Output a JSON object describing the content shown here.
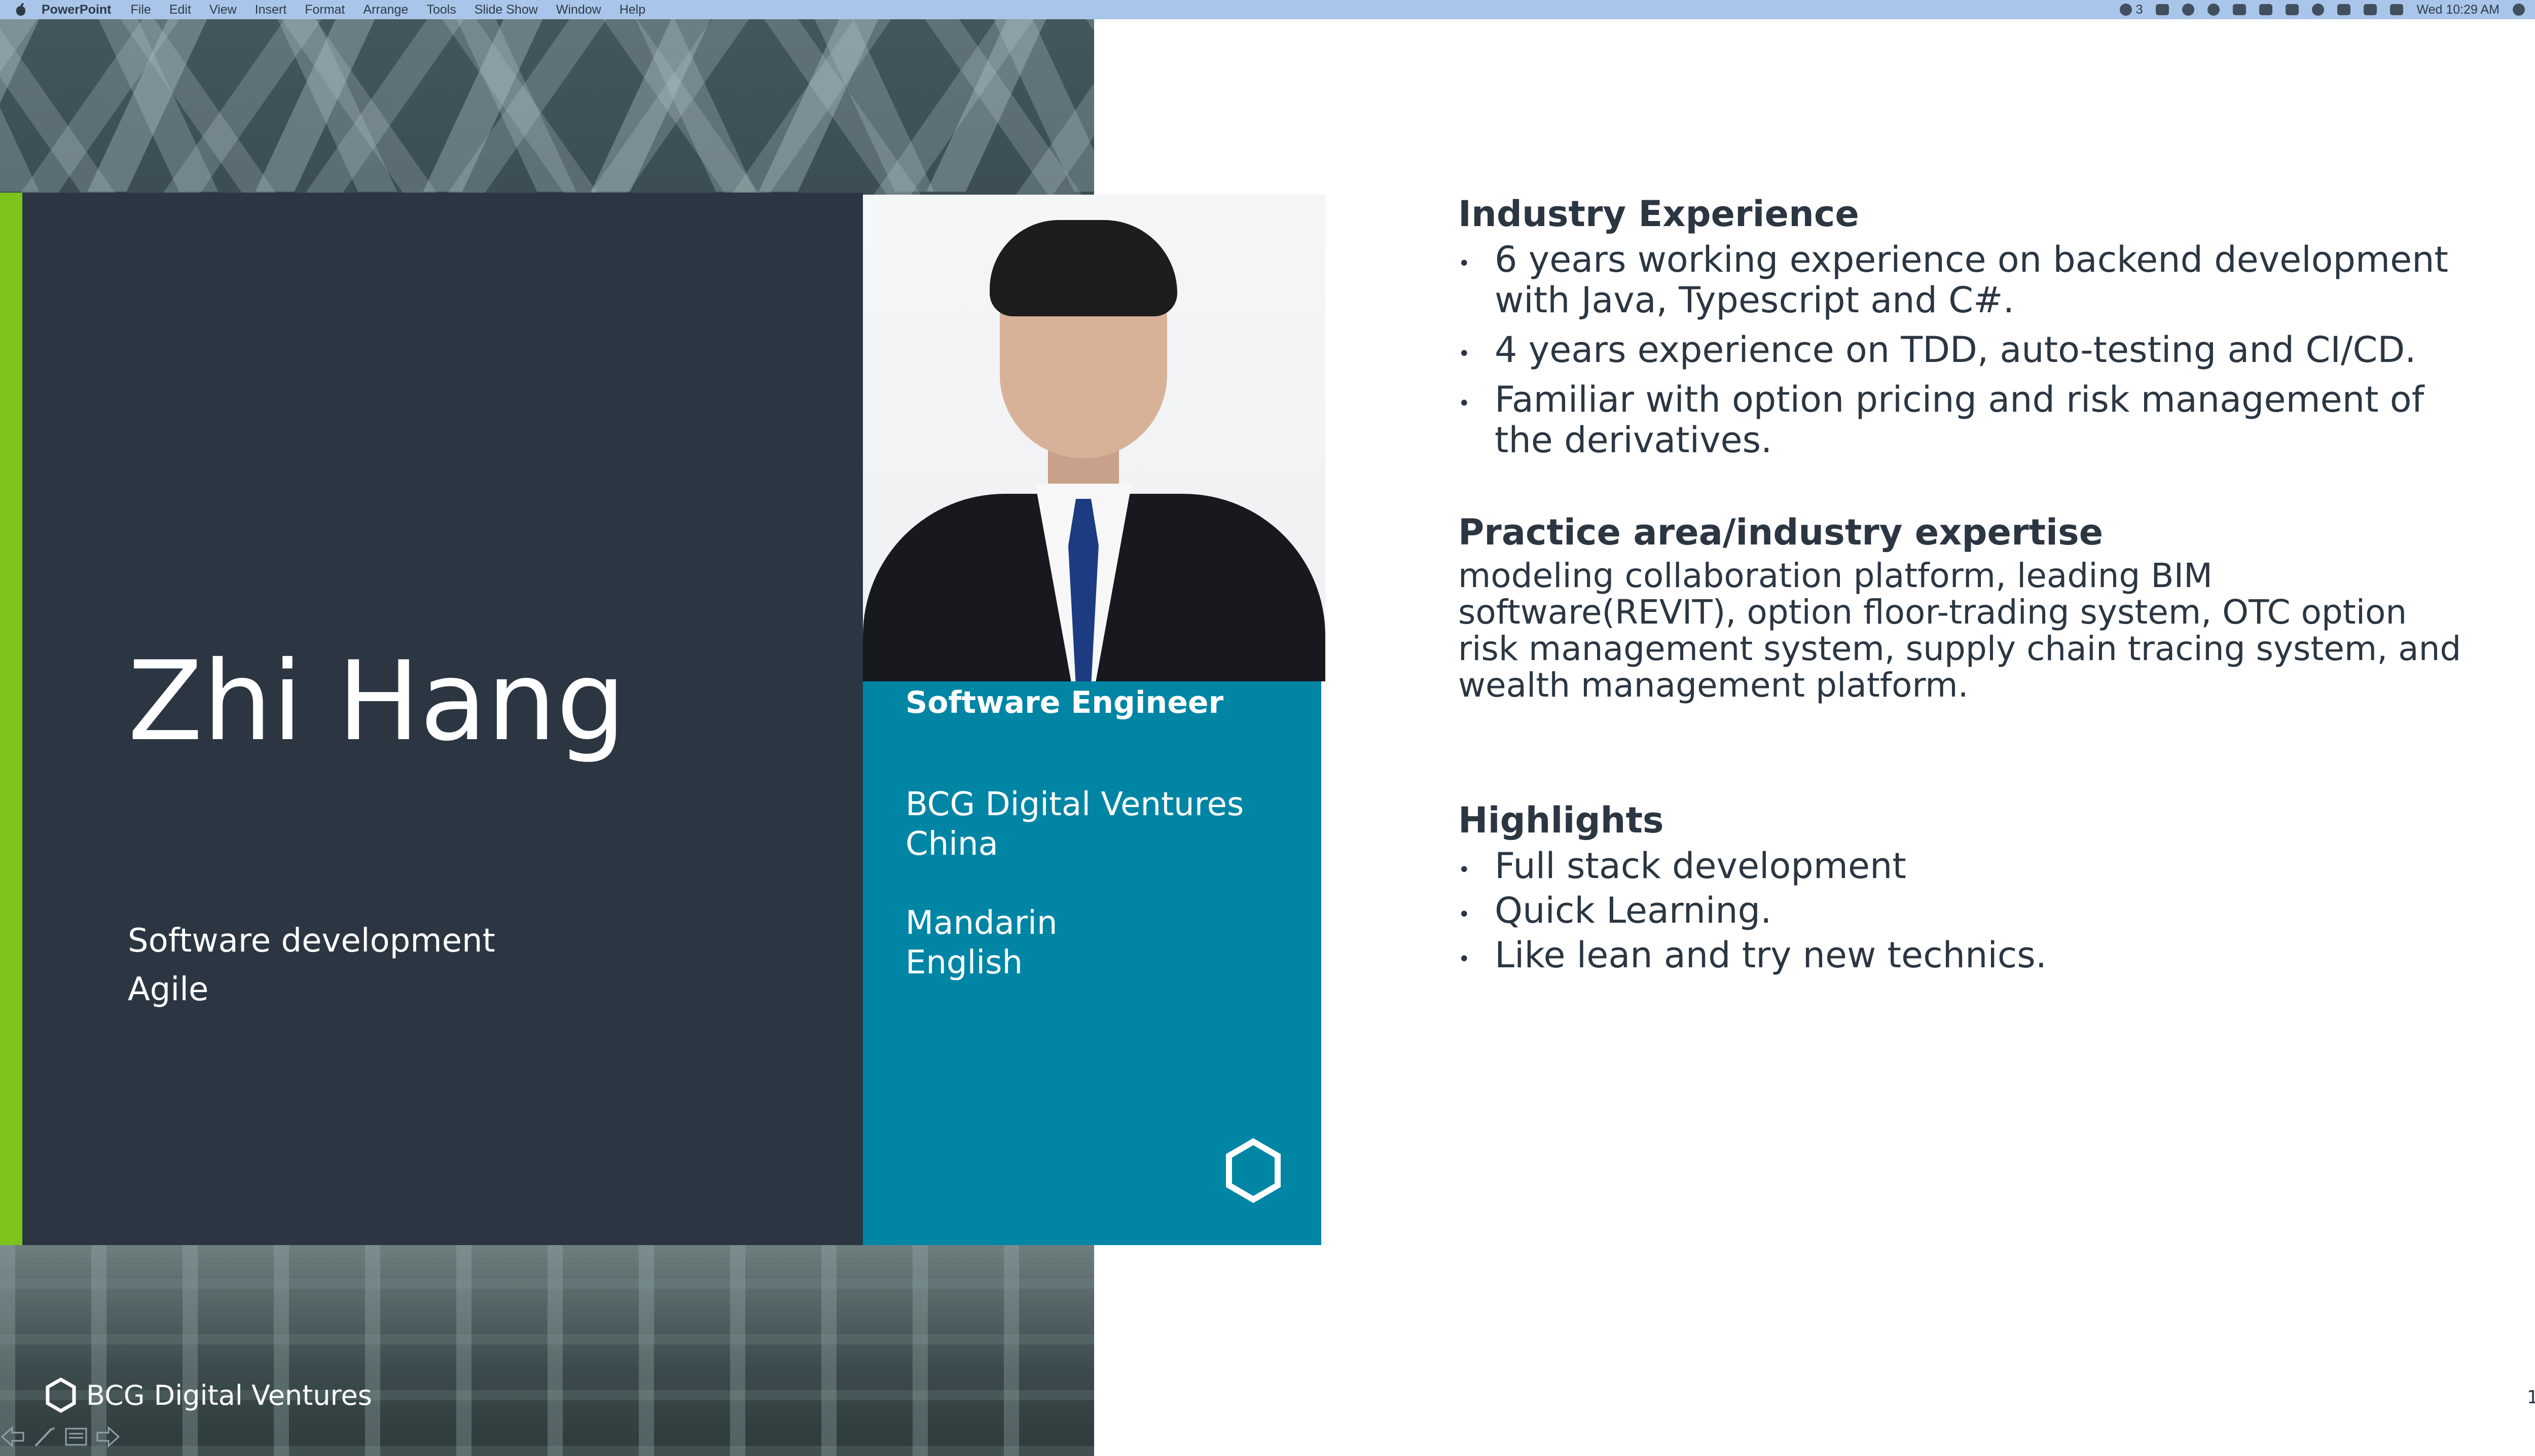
{
  "menubar": {
    "app_name": "PowerPoint",
    "items": [
      "File",
      "Edit",
      "View",
      "Insert",
      "Format",
      "Arrange",
      "Tools",
      "Slide Show",
      "Window",
      "Help"
    ],
    "wechat_count": "3",
    "clock": "Wed 10:29 AM"
  },
  "slide": {
    "name": "Zhi Hang",
    "skills": [
      "Software development",
      "Agile"
    ],
    "role": "Software Engineer",
    "company_lines": [
      "BCG Digital Ventures",
      "China"
    ],
    "language_lines": [
      "Mandarin",
      "English"
    ],
    "experience": {
      "title": "Industry Experience",
      "items": [
        "6 years working experience on backend development with Java, Typescript and C#.",
        "4 years experience on TDD, auto-testing and CI/CD.",
        "Familiar with option pricing and risk management of the derivatives."
      ]
    },
    "practice": {
      "title": "Practice area/industry expertise",
      "text": "modeling collaboration platform, leading BIM software(REVIT), option floor-trading system, OTC option risk management system, supply chain tracing system, and wealth management platform."
    },
    "highlights": {
      "title": "Highlights",
      "items": [
        "Full stack development",
        "Quick Learning.",
        "Like lean and try new technics."
      ]
    },
    "footer": {
      "brand_prefix": "BCG",
      "brand_name": "Digital Ventures"
    },
    "page_number": "1"
  },
  "colors": {
    "menubar": "#a9c6ea",
    "green_accent": "#7ec21c",
    "dark_panel": "#2b3642",
    "teal_panel": "#0085a5",
    "text_dark": "#2b3642"
  }
}
